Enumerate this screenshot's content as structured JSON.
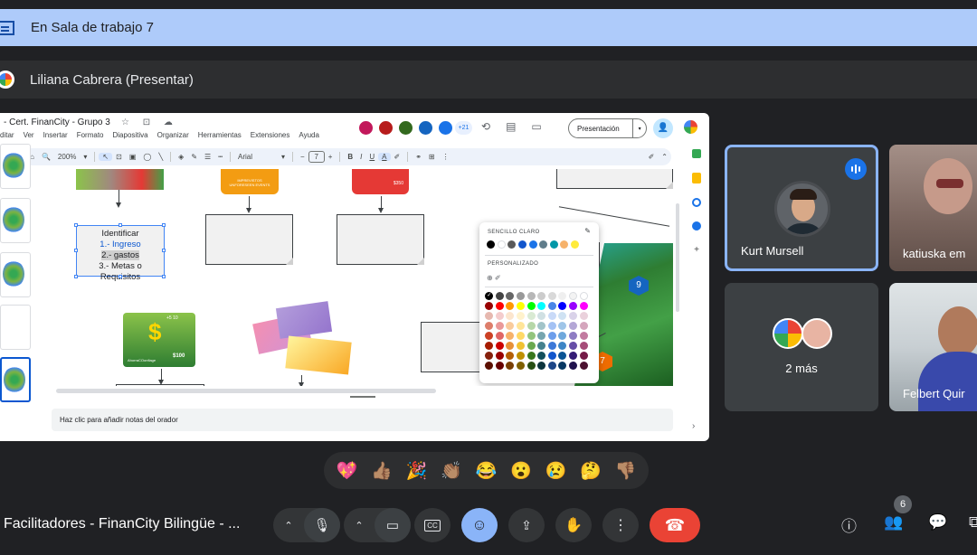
{
  "breakout": {
    "title": "En Sala de trabajo 7"
  },
  "presenter": {
    "title": "Liliana Cabrera (Presentar)"
  },
  "slides": {
    "doc_title": "- Cert. FinanCity - Grupo 3",
    "title_icons": "☆ ⊡ ☁",
    "menu": [
      "ditar",
      "Ver",
      "Insertar",
      "Formato",
      "Diapositiva",
      "Organizar",
      "Herramientas",
      "Extensiones",
      "Ayuda"
    ],
    "collab_count": "+21",
    "present_label": "Presentación",
    "zoom": "200%",
    "font": "Arial",
    "font_size": "7",
    "notes_placeholder": "Haz clic para añadir notas del orador",
    "textbox": {
      "line1": "Identificar",
      "line2": "1.- Ingreso",
      "line3": "2.- gastos",
      "line4": "3.- Metas o",
      "line5": "Requisitos"
    },
    "img_money_amount": "$100",
    "img_money_top": "+5  10",
    "img_money_brand": "AhorraCOonfiage",
    "img_card1": "IMPREVISTOS\nUNFORESEEN EVENTS",
    "img_card2_amount": "$350",
    "badge_9": "9",
    "badge_7": "7"
  },
  "color_picker": {
    "label_simple": "SENCILLO CLARO",
    "label_custom": "PERSONALIZADO",
    "simple_colors": [
      "#000000",
      "#ffffff",
      "#595959",
      "#1155cc",
      "#1a73e8",
      "#607d8b",
      "#0097a7",
      "#f6b26b",
      "#ffeb3b"
    ],
    "palette_top": [
      "#000000",
      "#434343",
      "#666666",
      "#999999",
      "#b7b7b7",
      "#cccccc",
      "#d9d9d9",
      "#efefef",
      "#f3f3f3",
      "#ffffff"
    ],
    "palette_bright": [
      "#980000",
      "#ff0000",
      "#ff9900",
      "#ffff00",
      "#00ff00",
      "#00ffff",
      "#4a86e8",
      "#0000ff",
      "#9900ff",
      "#ff00ff"
    ],
    "palette_rows": [
      [
        "#e6b8af",
        "#f4cccc",
        "#fce5cd",
        "#fff2cc",
        "#d9ead3",
        "#d0e0e3",
        "#c9daf8",
        "#cfe2f3",
        "#d9d2e9",
        "#ead1dc"
      ],
      [
        "#dd7e6b",
        "#ea9999",
        "#f9cb9c",
        "#ffe599",
        "#b6d7a8",
        "#a2c4c9",
        "#a4c2f4",
        "#9fc5e8",
        "#b4a7d6",
        "#d5a6bd"
      ],
      [
        "#cc4125",
        "#e06666",
        "#f6b26b",
        "#ffd966",
        "#93c47d",
        "#76a5af",
        "#6d9eeb",
        "#6fa8dc",
        "#8e7cc3",
        "#c27ba0"
      ],
      [
        "#a61c00",
        "#cc0000",
        "#e69138",
        "#f1c232",
        "#6aa84f",
        "#45818e",
        "#3c78d8",
        "#3d85c6",
        "#674ea7",
        "#a64d79"
      ],
      [
        "#85200c",
        "#990000",
        "#b45f06",
        "#bf9000",
        "#38761d",
        "#134f5c",
        "#1155cc",
        "#0b5394",
        "#351c75",
        "#741b47"
      ],
      [
        "#5b0f00",
        "#660000",
        "#783f04",
        "#7f6000",
        "#274e13",
        "#0c343d",
        "#1c4587",
        "#073763",
        "#20124d",
        "#4c1130"
      ]
    ]
  },
  "participants": [
    {
      "name": "Kurt Mursell",
      "speaking": true
    },
    {
      "name": "katiuska em"
    },
    {
      "name": "2 más"
    },
    {
      "name": "Felbert Quir"
    }
  ],
  "reactions": [
    "💖",
    "👍🏽",
    "🎉",
    "👏🏽",
    "😂",
    "😮",
    "😢",
    "🤔",
    "👎🏽"
  ],
  "meeting": {
    "title": "Facilitadores - FinanCity Bilingüe - ...",
    "participant_count": "6"
  },
  "colors": {
    "accent": "#8ab4f8",
    "end_call": "#ea4335",
    "bg": "#202124"
  }
}
